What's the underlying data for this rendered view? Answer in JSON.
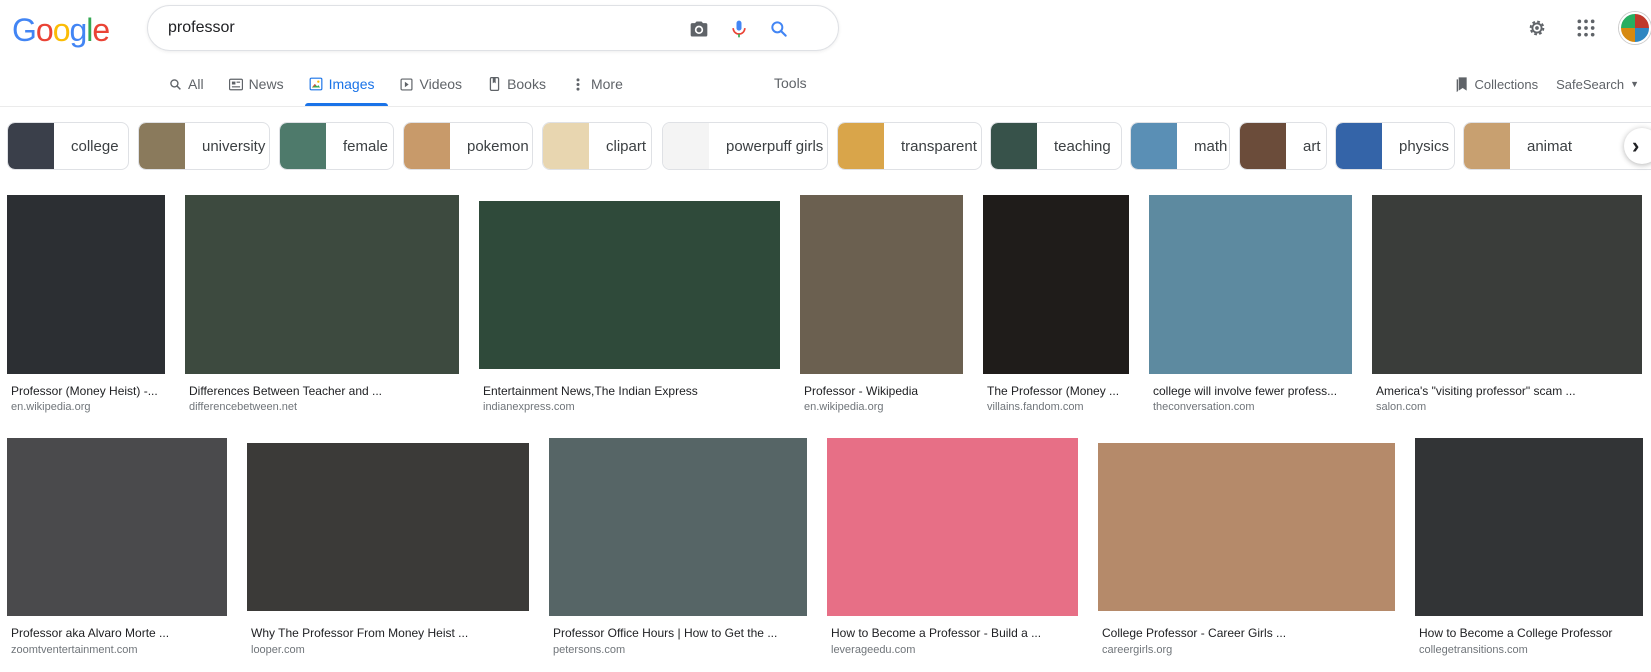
{
  "logo": [
    "G",
    "o",
    "o",
    "g",
    "l",
    "e"
  ],
  "search": {
    "value": "professor"
  },
  "icons": {
    "camera": "camera-icon",
    "mic": "microphone-icon",
    "search": "search-icon",
    "settings": "gear-icon",
    "apps": "apps-grid-icon"
  },
  "tabs": [
    {
      "label": "All",
      "icon": "search-icon"
    },
    {
      "label": "News",
      "icon": "news-icon"
    },
    {
      "label": "Images",
      "icon": "image-icon"
    },
    {
      "label": "Videos",
      "icon": "video-icon"
    },
    {
      "label": "Books",
      "icon": "book-icon"
    },
    {
      "label": "More",
      "icon": "more-vert-icon"
    }
  ],
  "tools_label": "Tools",
  "collections_label": "Collections",
  "safesearch_label": "SafeSearch",
  "chips": [
    {
      "label": "college",
      "color": "#3a3f4a"
    },
    {
      "label": "university",
      "color": "#8a7a5c"
    },
    {
      "label": "female",
      "color": "#4e7a6b"
    },
    {
      "label": "pokemon",
      "color": "#c89a6a"
    },
    {
      "label": "clipart",
      "color": "#e8d6b0"
    },
    {
      "label": "powerpuff girls",
      "color": "#f4f4f4"
    },
    {
      "label": "transparent",
      "color": "#d9a54a"
    },
    {
      "label": "teaching",
      "color": "#37524a"
    },
    {
      "label": "math",
      "color": "#5a8fb5"
    },
    {
      "label": "art",
      "color": "#6b4c3a"
    },
    {
      "label": "physics",
      "color": "#3464a8"
    },
    {
      "label": "animat",
      "color": "#c8a070"
    }
  ],
  "results": [
    {
      "title": "Professor (Money Heist) -...",
      "source": "en.wikipedia.org",
      "color": "#2c2f33"
    },
    {
      "title": "Differences Between Teacher and ...",
      "source": "differencebetween.net",
      "color": "#3d4a3f"
    },
    {
      "title": "Entertainment News,The Indian Express",
      "source": "indianexpress.com",
      "color": "#2f4a3a"
    },
    {
      "title": "Professor - Wikipedia",
      "source": "en.wikipedia.org",
      "color": "#6b6050"
    },
    {
      "title": "The Professor (Money ...",
      "source": "villains.fandom.com",
      "color": "#1f1c1a"
    },
    {
      "title": "college will involve fewer profess...",
      "source": "theconversation.com",
      "color": "#5d8aa0"
    },
    {
      "title": "America's \"visiting professor\" scam ...",
      "source": "salon.com",
      "color": "#3a3d3a"
    },
    {
      "title": "Professor aka Alvaro Morte ...",
      "source": "zoomtventertainment.com",
      "color": "#4a4a4c"
    },
    {
      "title": "Why The Professor From Money Heist ...",
      "source": "looper.com",
      "color": "#3b3a38"
    },
    {
      "title": "Professor Office Hours | How to Get the ...",
      "source": "petersons.com",
      "color": "#566566"
    },
    {
      "title": "How to Become a Professor - Build a ...",
      "source": "leverageedu.com",
      "color": "#e76f86"
    },
    {
      "title": "College Professor - Career Girls ...",
      "source": "careergirls.org",
      "color": "#b58a6a"
    },
    {
      "title": "How to Become a College Professor",
      "source": "collegetransitions.com",
      "color": "#323436"
    }
  ]
}
